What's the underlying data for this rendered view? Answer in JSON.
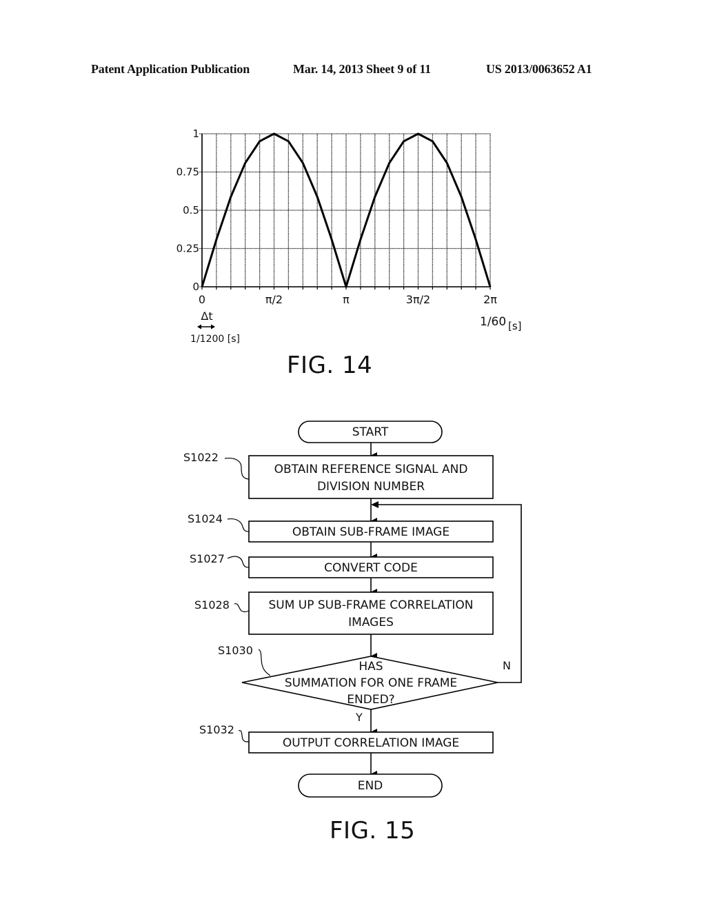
{
  "header": {
    "publication_type": "Patent Application Publication",
    "date_sheet": "Mar. 14, 2013  Sheet 9 of 11",
    "publication_number": "US 2013/0063652 A1"
  },
  "figures": {
    "fig14_caption": "FIG. 14",
    "fig15_caption": "FIG. 15"
  },
  "chart_data": {
    "type": "line",
    "title": "",
    "xlabel": "1/60[s]",
    "ylabel": "",
    "x_divisions": 20,
    "x": [
      0,
      0.05,
      0.1,
      0.15,
      0.2,
      0.25,
      0.3,
      0.35,
      0.4,
      0.45,
      0.5,
      0.55,
      0.6,
      0.65,
      0.7,
      0.75,
      0.8,
      0.85,
      0.9,
      0.95,
      1.0
    ],
    "x_unit_note": "fraction of 2π period",
    "values": [
      0,
      0.309,
      0.588,
      0.809,
      0.951,
      1.0,
      0.951,
      0.809,
      0.588,
      0.309,
      0,
      0.309,
      0.588,
      0.809,
      0.951,
      1.0,
      0.951,
      0.809,
      0.588,
      0.309,
      0
    ],
    "ylim": [
      0,
      1
    ],
    "xlim": [
      0,
      1
    ],
    "y_ticks": [
      "0",
      "0.25",
      "0.5",
      "0.75",
      "1"
    ],
    "y_tick_values": [
      0,
      0.25,
      0.5,
      0.75,
      1
    ],
    "x_ticks": [
      "0",
      "π/2",
      "π",
      "3π/2",
      "2π"
    ],
    "x_tick_values": [
      0,
      0.25,
      0.5,
      0.75,
      1.0
    ],
    "grid": true,
    "annotations": {
      "delta_label": "Δt",
      "delta_value": "1/1200 [s]",
      "period_label": "1/60",
      "period_unit": "[s]"
    }
  },
  "flowchart": {
    "start": "START",
    "end": "END",
    "steps": [
      {
        "id": "S1022",
        "lines": [
          "OBTAIN REFERENCE SIGNAL AND",
          "DIVISION NUMBER"
        ]
      },
      {
        "id": "S1024",
        "lines": [
          "OBTAIN SUB-FRAME IMAGE"
        ]
      },
      {
        "id": "S1027",
        "lines": [
          "CONVERT CODE"
        ]
      },
      {
        "id": "S1028",
        "lines": [
          "SUM UP SUB-FRAME CORRELATION",
          "IMAGES"
        ]
      },
      {
        "id": "S1032",
        "lines": [
          "OUTPUT CORRELATION IMAGE"
        ]
      }
    ],
    "decision": {
      "id": "S1030",
      "lines": [
        "HAS",
        "SUMMATION FOR ONE FRAME",
        "ENDED?"
      ],
      "yes_label": "Y",
      "no_label": "N"
    }
  }
}
